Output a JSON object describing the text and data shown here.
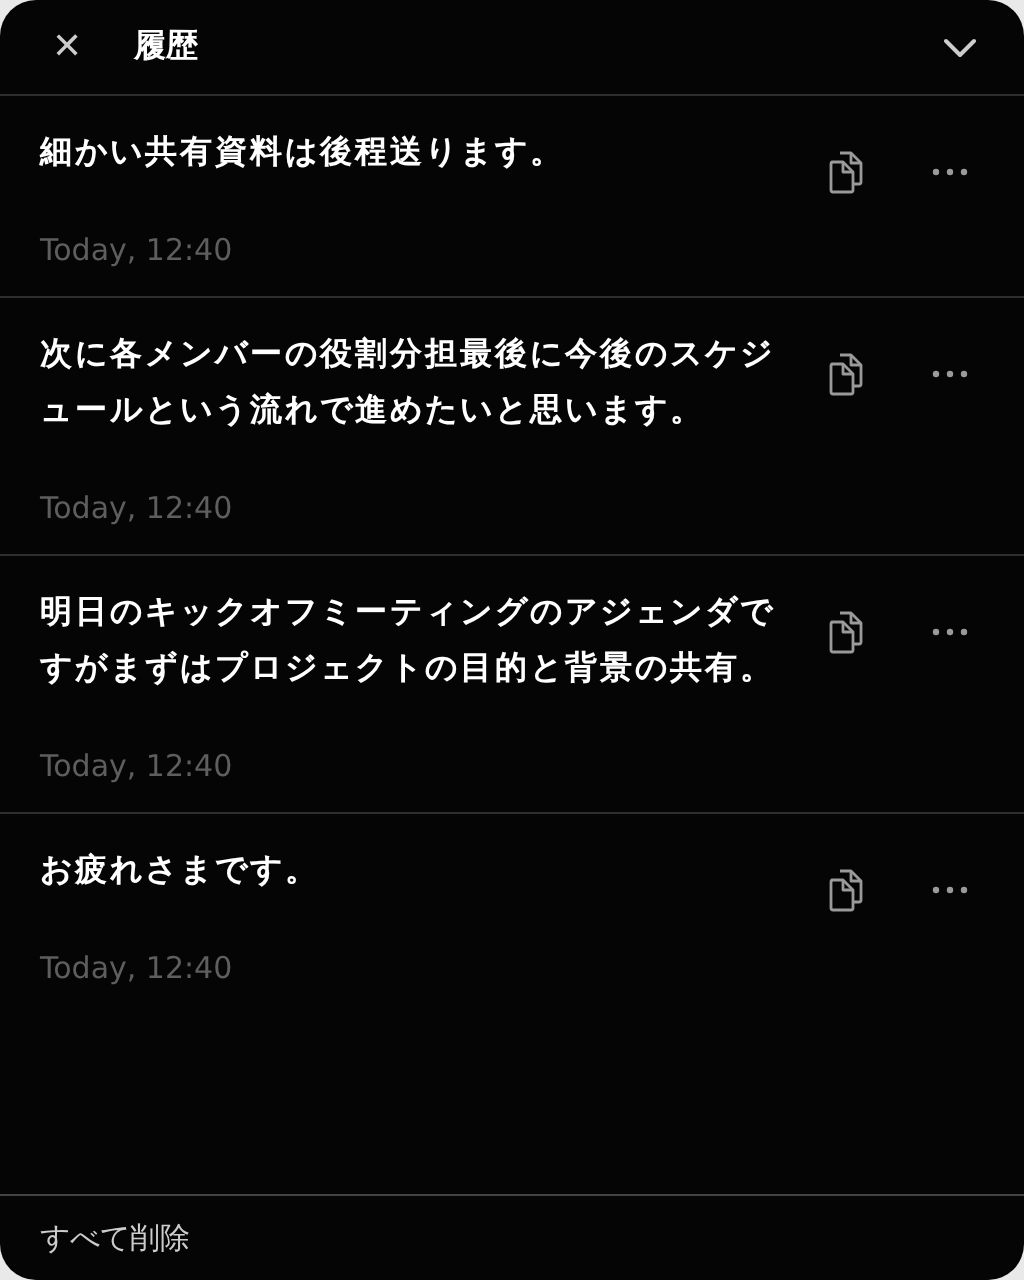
{
  "header": {
    "close": "✕",
    "title": "履歴"
  },
  "entries": [
    {
      "text": "細かい共有資料は後程送ります。",
      "time": "Today, 12:40"
    },
    {
      "text": "次に各メンバーの役割分担最後に今後のスケジュールという流れで進めたいと思います。",
      "time": "Today, 12:40"
    },
    {
      "text": "明日のキックオフミーティングのアジェンダですがまずはプロジェクトの目的と背景の共有。",
      "time": "Today, 12:40"
    },
    {
      "text": "お疲れさまです。",
      "time": "Today, 12:40"
    }
  ],
  "footer": {
    "clear_all": "すべて削除"
  }
}
